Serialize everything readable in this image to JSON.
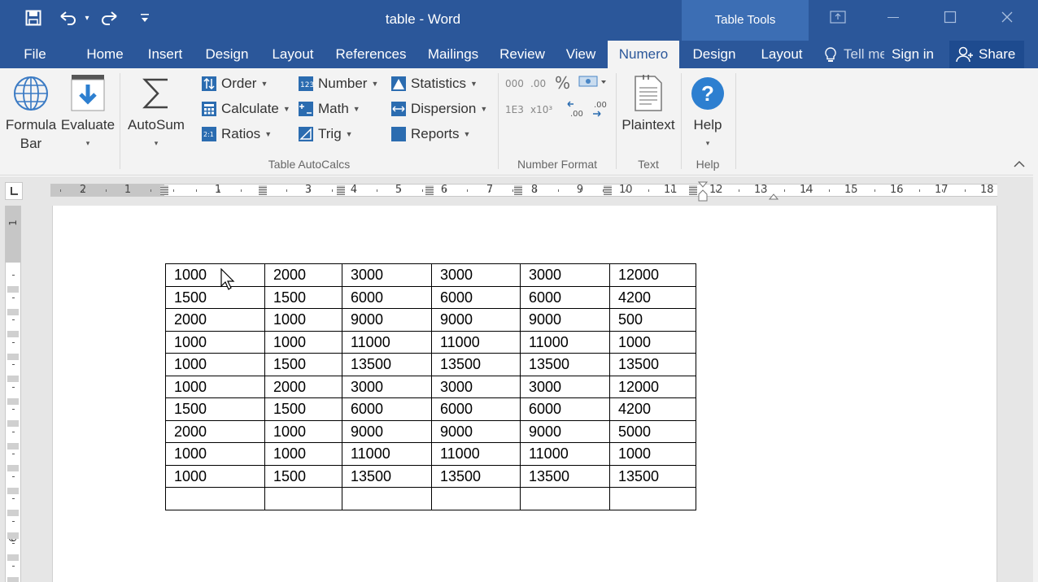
{
  "window": {
    "title": "table - Word",
    "context_banner": "Table Tools"
  },
  "qat": {
    "save_icon": "save-icon",
    "undo_icon": "undo-icon",
    "redo_icon": "redo-icon",
    "customize_icon": "customize-qat-icon"
  },
  "tabs": {
    "file": "File",
    "home": "Home",
    "insert": "Insert",
    "design": "Design",
    "layout": "Layout",
    "references": "References",
    "mailings": "Mailings",
    "review": "Review",
    "view": "View",
    "numero": "Numero",
    "table_design": "Design",
    "table_layout": "Layout",
    "tell_me": "Tell me",
    "sign_in": "Sign in",
    "share": "Share"
  },
  "ribbon": {
    "formula_bar": "Formula Bar",
    "formula_bar_line1": "Formula",
    "formula_bar_line2": "Bar",
    "evaluate": "Evaluate",
    "autosum": "AutoSum",
    "order": "Order",
    "calculate": "Calculate",
    "ratios": "Ratios",
    "number": "Number",
    "math": "Math",
    "trig": "Trig",
    "statistics": "Statistics",
    "dispersion": "Dispersion",
    "reports": "Reports",
    "plaintext": "Plaintext",
    "help": "Help",
    "groups": {
      "table_autocalcs": "Table AutoCalcs",
      "number_format": "Number Format",
      "text": "Text",
      "help": "Help"
    },
    "number_format": {
      "thousands": "000",
      "decimal": ".00",
      "percent": "%",
      "scientific": "1E3",
      "power": "x10³"
    },
    "accent": "#2b579a"
  },
  "ruler": {
    "h_numbers": [
      "2",
      "1",
      "1",
      "3",
      "4",
      "5",
      "6",
      "7",
      "8",
      "9",
      "10",
      "11",
      "12",
      "13",
      "14",
      "15",
      "16",
      "17",
      "18"
    ],
    "v_numbers": [
      "1",
      "6",
      "7"
    ]
  },
  "table": {
    "rows": [
      [
        "1000",
        "2000",
        "3000",
        "3000",
        "3000",
        "12000"
      ],
      [
        "1500",
        "1500",
        "6000",
        "6000",
        "6000",
        "4200"
      ],
      [
        "2000",
        "1000",
        "9000",
        "9000",
        "9000",
        "500"
      ],
      [
        "1000",
        "1000",
        "11000",
        "11000",
        "11000",
        "1000"
      ],
      [
        "1000",
        "1500",
        "13500",
        "13500",
        "13500",
        "13500"
      ],
      [
        "1000",
        "2000",
        "3000",
        "3000",
        "3000",
        "12000"
      ],
      [
        "1500",
        "1500",
        "6000",
        "6000",
        "6000",
        "4200"
      ],
      [
        "2000",
        "1000",
        "9000",
        "9000",
        "9000",
        "5000"
      ],
      [
        "1000",
        "1000",
        "11000",
        "11000",
        "11000",
        "1000"
      ],
      [
        "1000",
        "1500",
        "13500",
        "13500",
        "13500",
        "13500"
      ],
      [
        "",
        "",
        "",
        "",
        "",
        ""
      ]
    ]
  }
}
